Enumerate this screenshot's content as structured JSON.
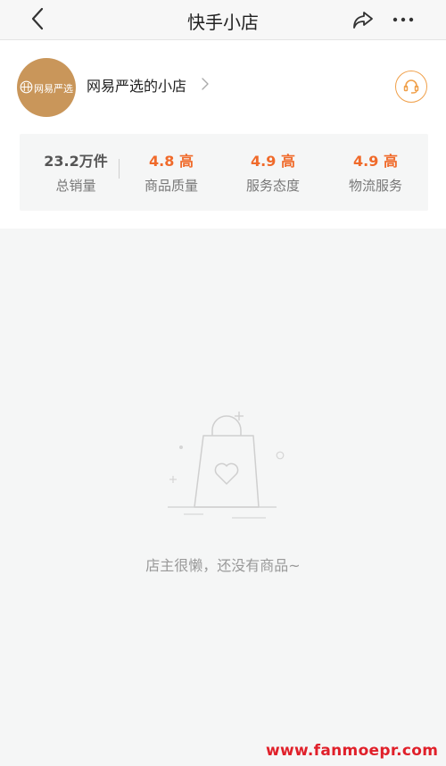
{
  "nav": {
    "title": "快手小店",
    "back_icon": "chevron-left-icon",
    "share_icon": "share-icon",
    "more_icon": "more-icon"
  },
  "shop": {
    "avatar_text": "网易严选",
    "name": "网易严选的小店",
    "avatar_color": "#c9965a",
    "service_icon": "customer-service-icon",
    "accent_color": "#f0a04a"
  },
  "stats": [
    {
      "value": "23.2万件",
      "label": "总销量"
    },
    {
      "value": "4.8 高",
      "label": "商品质量"
    },
    {
      "value": "4.9 高",
      "label": "服务态度"
    },
    {
      "value": "4.9 高",
      "label": "物流服务"
    }
  ],
  "empty": {
    "icon": "empty-shopping-bag-icon",
    "message": "店主很懒，还没有商品~"
  },
  "watermark": "www.fanmoepr.com",
  "colors": {
    "orange": "#f06a2a",
    "watermark": "#e0202a"
  }
}
